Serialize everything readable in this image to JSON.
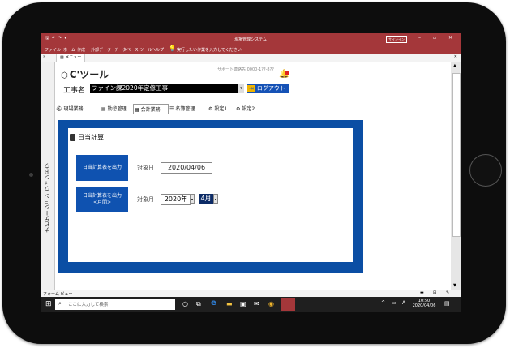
{
  "window": {
    "title": "現場管理システム",
    "signin": "サインイン"
  },
  "ribbon": {
    "tabs": [
      "ファイル",
      "ホーム",
      "作成",
      "外部データ",
      "データベース ツール",
      "ヘルプ"
    ],
    "tell_me": "実行したい作業を入力してください"
  },
  "doc_tab": "メニュー",
  "left_nav_label": "ナビゲーション ウィンドウ",
  "app": {
    "logo": "C'ツール",
    "support": "サポート連絡先 0000-1??-8??",
    "project_label": "工事名",
    "project_value": "ファイン課2020年定修工事",
    "logout": "ログアウト"
  },
  "tabs": [
    {
      "label": "現場業務",
      "icon": "helmet-icon"
    },
    {
      "label": "勤怠管理",
      "icon": "calendar-icon"
    },
    {
      "label": "会計業務",
      "icon": "calculator-icon"
    },
    {
      "label": "名簿管理",
      "icon": "list-icon"
    },
    {
      "label": "設定1",
      "icon": "gear-icon"
    },
    {
      "label": "設定2",
      "icon": "gear-icon"
    }
  ],
  "section": {
    "title": "日当計算",
    "btn_daily": "日当計算表を出力",
    "btn_monthly_line1": "日当計算表を出力",
    "btn_monthly_line2": "<月間>",
    "date_label": "対象日",
    "date_value": "2020/04/06",
    "month_label": "対象月",
    "year_value": "2020年",
    "month_value": "4月"
  },
  "statusbar": {
    "left": "フォーム ビュー"
  },
  "taskbar": {
    "search_placeholder": "ここに入力して検索",
    "time": "10:50",
    "date": "2020/04/06",
    "ime": "A"
  }
}
